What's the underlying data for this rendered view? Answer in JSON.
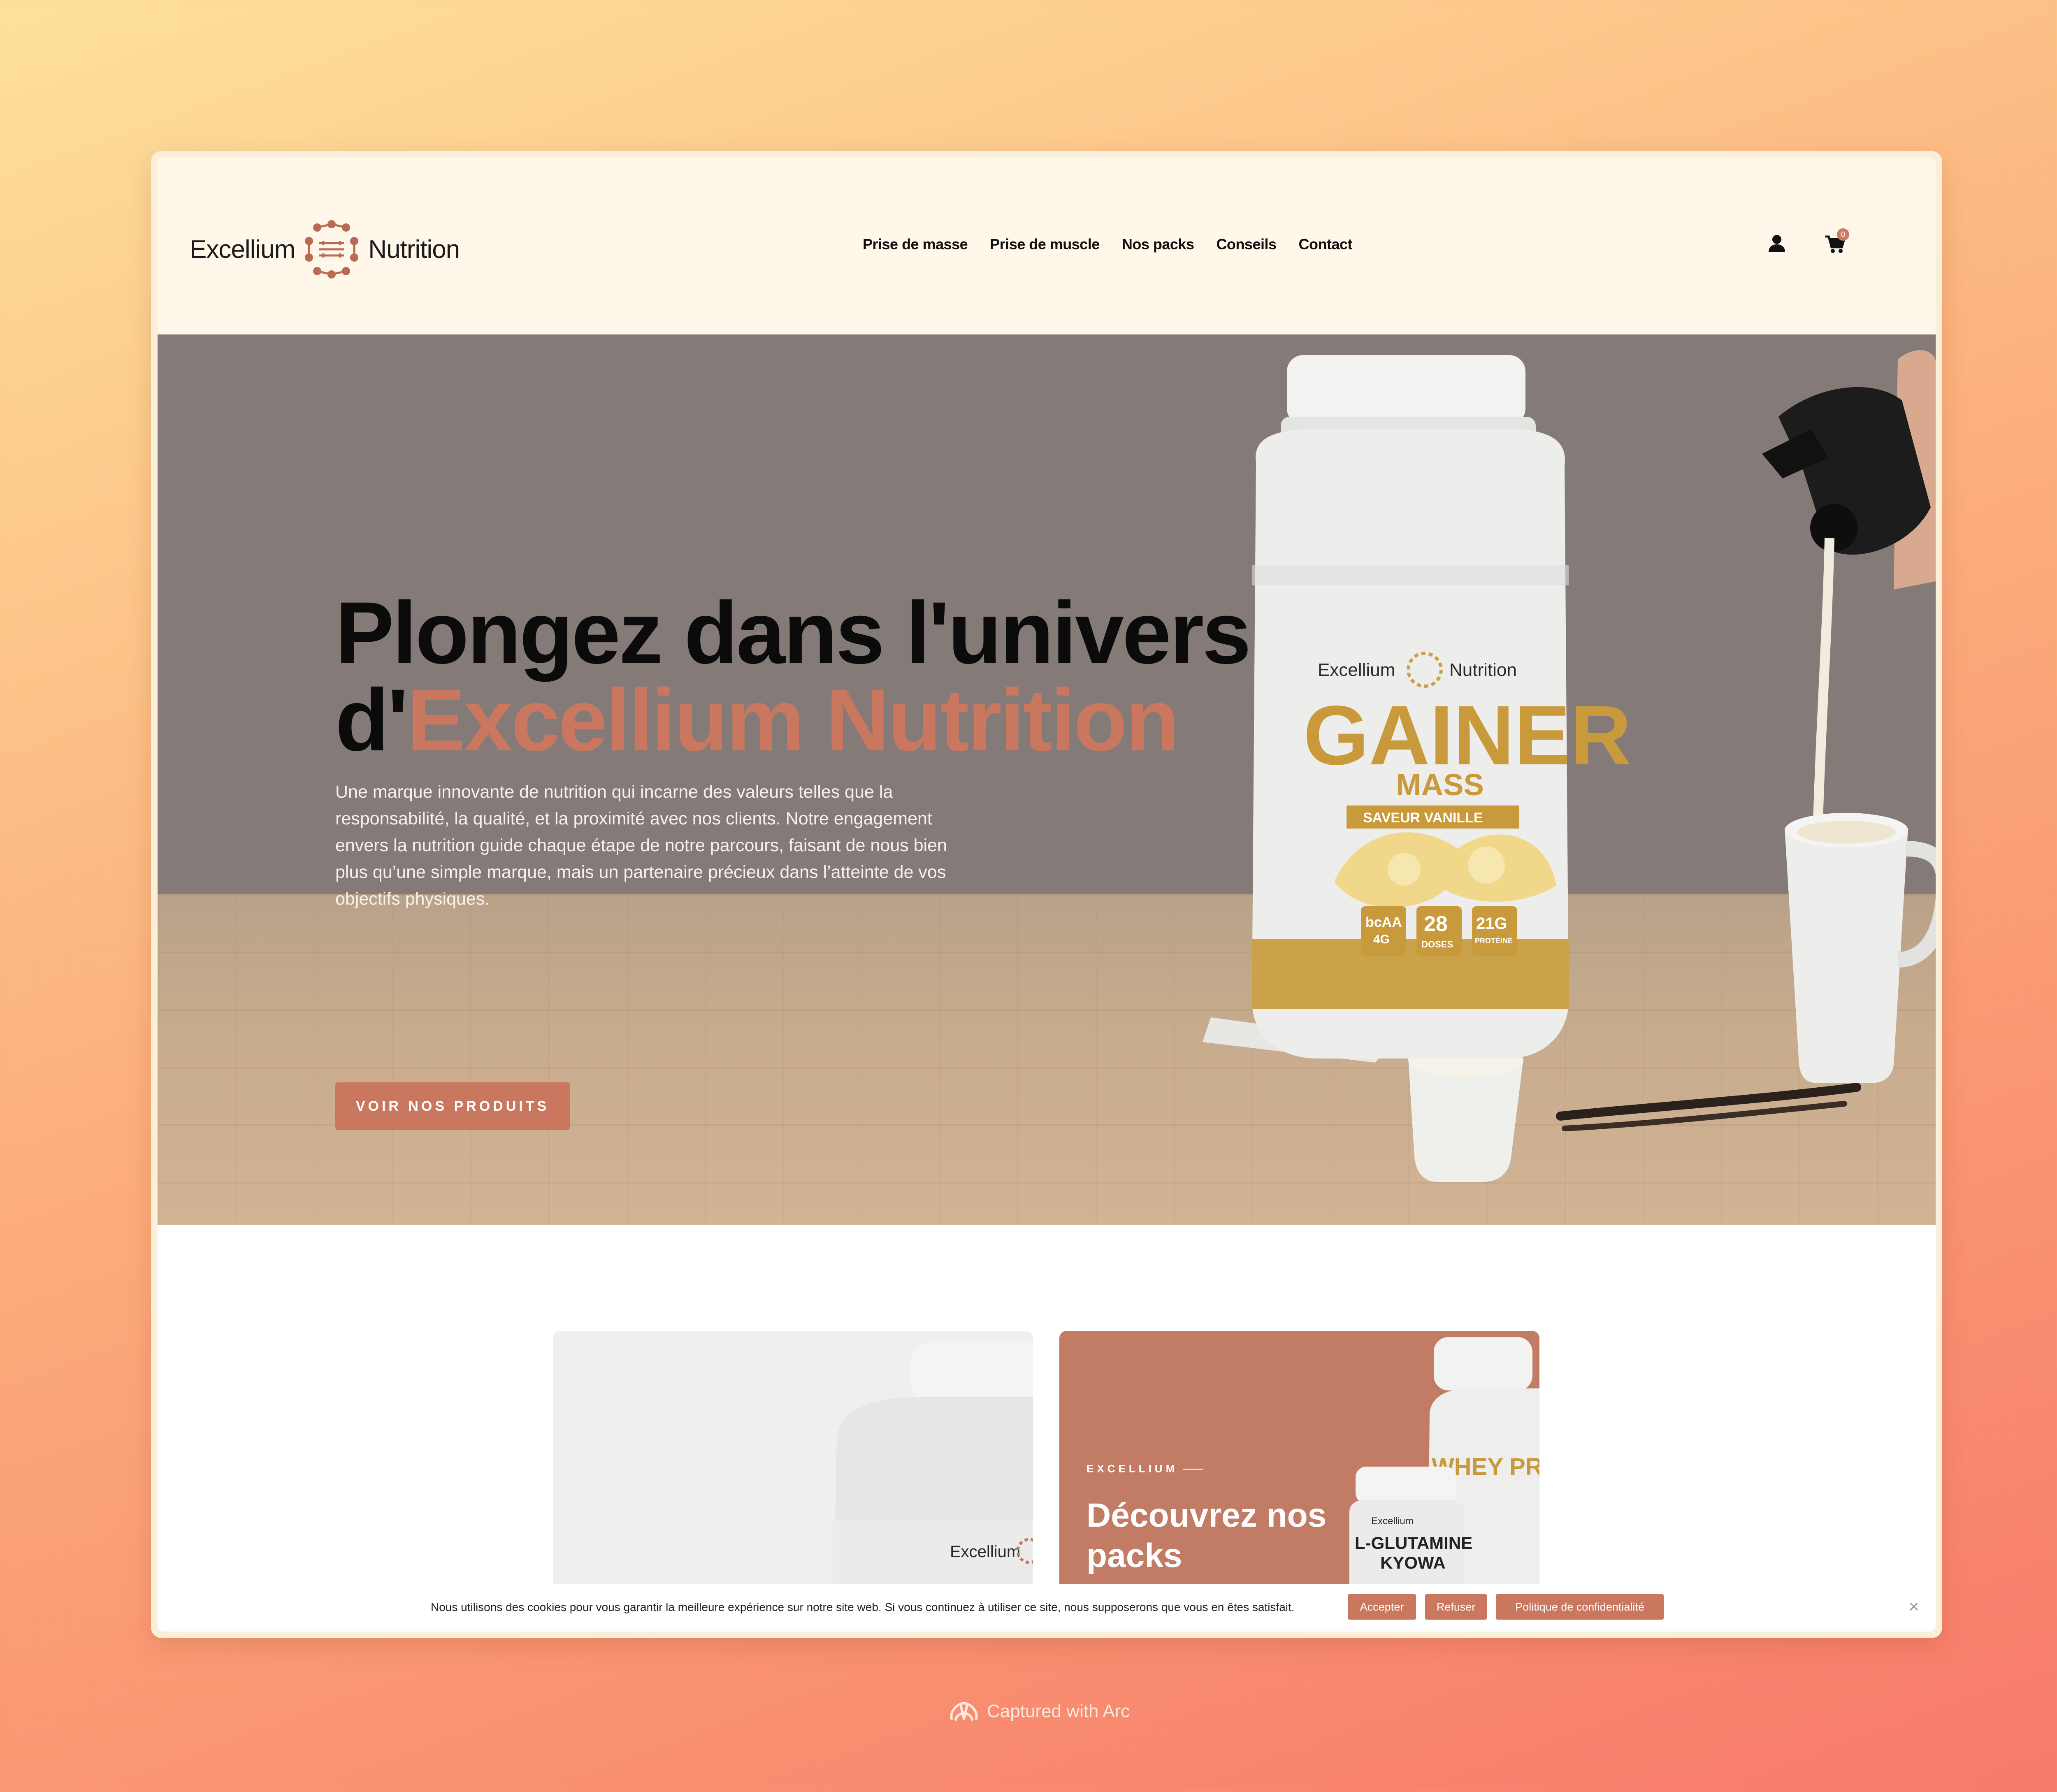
{
  "brand": {
    "name_left": "Excellium",
    "name_right": "Nutrition",
    "accent": "#c9775f"
  },
  "nav": {
    "items": [
      {
        "label": "Prise de masse"
      },
      {
        "label": "Prise de muscle"
      },
      {
        "label": "Nos packs"
      },
      {
        "label": "Conseils"
      },
      {
        "label": "Contact"
      }
    ]
  },
  "header": {
    "account_icon": "user-icon",
    "cart_icon": "cart-icon",
    "cart_count": "0"
  },
  "hero": {
    "title_line1": "Plongez dans l'univers",
    "title_prefix": "d'",
    "title_accent": "Excellium Nutrition",
    "description": "Une marque innovante de nutrition qui incarne des valeurs telles que la responsabilité, la qualité, et la proximité avec nos clients. Notre engagement envers la nutrition guide chaque étape de notre parcours, faisant de nous bien plus qu’une simple marque, mais un partenaire précieux dans l’atteinte de vos objectifs physiques.",
    "cta": "VOIR NOS PRODUITS",
    "product": {
      "brand_left": "Excellium",
      "brand_right": "Nutrition",
      "name": "GAINER",
      "subname": "MASS",
      "flavor": "SAVEUR VANILLE",
      "stat1_value": "bcAA",
      "stat1_sub": "4G",
      "stat2_value": "28",
      "stat2_sub": "DOSES",
      "stat3_value": "21G",
      "stat3_sub": "PROTÉINE"
    }
  },
  "cards": {
    "left": {
      "jar_brand": "Excellium"
    },
    "right": {
      "eyebrow": "EXCELLIUM",
      "title": "Découvrez nos packs",
      "jar1_brand": "Excellium",
      "jar1_name": "L-GLUTAMINE",
      "jar1_sub": "KYOWA",
      "jar2_name": "WHEY PR"
    }
  },
  "cookie": {
    "text": "Nous utilisons des cookies pour vous garantir la meilleure expérience sur notre site web. Si vous continuez à utiliser ce site, nous supposerons que vous en êtes satisfait.",
    "accept": "Accepter",
    "refuse": "Refuser",
    "policy": "Politique de confidentialité",
    "close": "×"
  },
  "watermark": {
    "text": "Captured with Arc"
  }
}
